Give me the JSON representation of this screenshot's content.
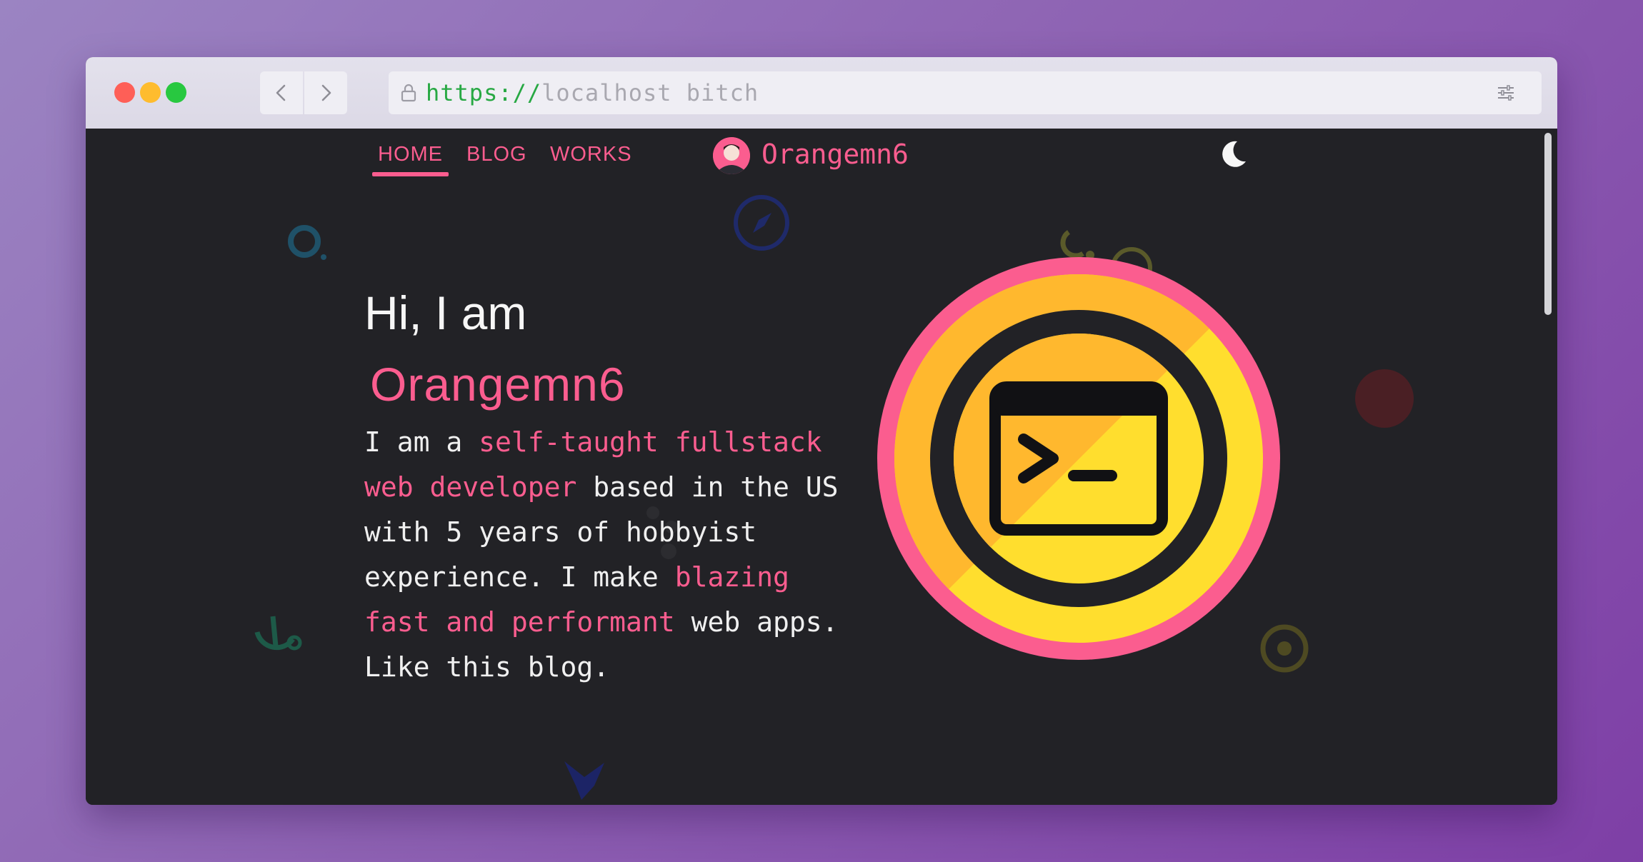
{
  "browser": {
    "url_scheme": "https://",
    "url_rest": "localhost bitch"
  },
  "nav": {
    "links": [
      "HOME",
      "BLOG",
      "WORKS"
    ],
    "brand": "Orangemn6"
  },
  "hero": {
    "greeting": "Hi, I am",
    "name": "Orangemn6",
    "bio": {
      "p1": "I am a ",
      "h1": "self-taught fullstack web developer",
      "p2": " based in the US with 5 years of hobbyist experience. I make ",
      "h2": "blazing fast and performant",
      "p3": " web apps. Like this blog."
    }
  },
  "colors": {
    "accent": "#fb5d8f",
    "background": "#222226",
    "logo_yellow": "#ffde2e",
    "logo_orange": "#ffb82e"
  }
}
